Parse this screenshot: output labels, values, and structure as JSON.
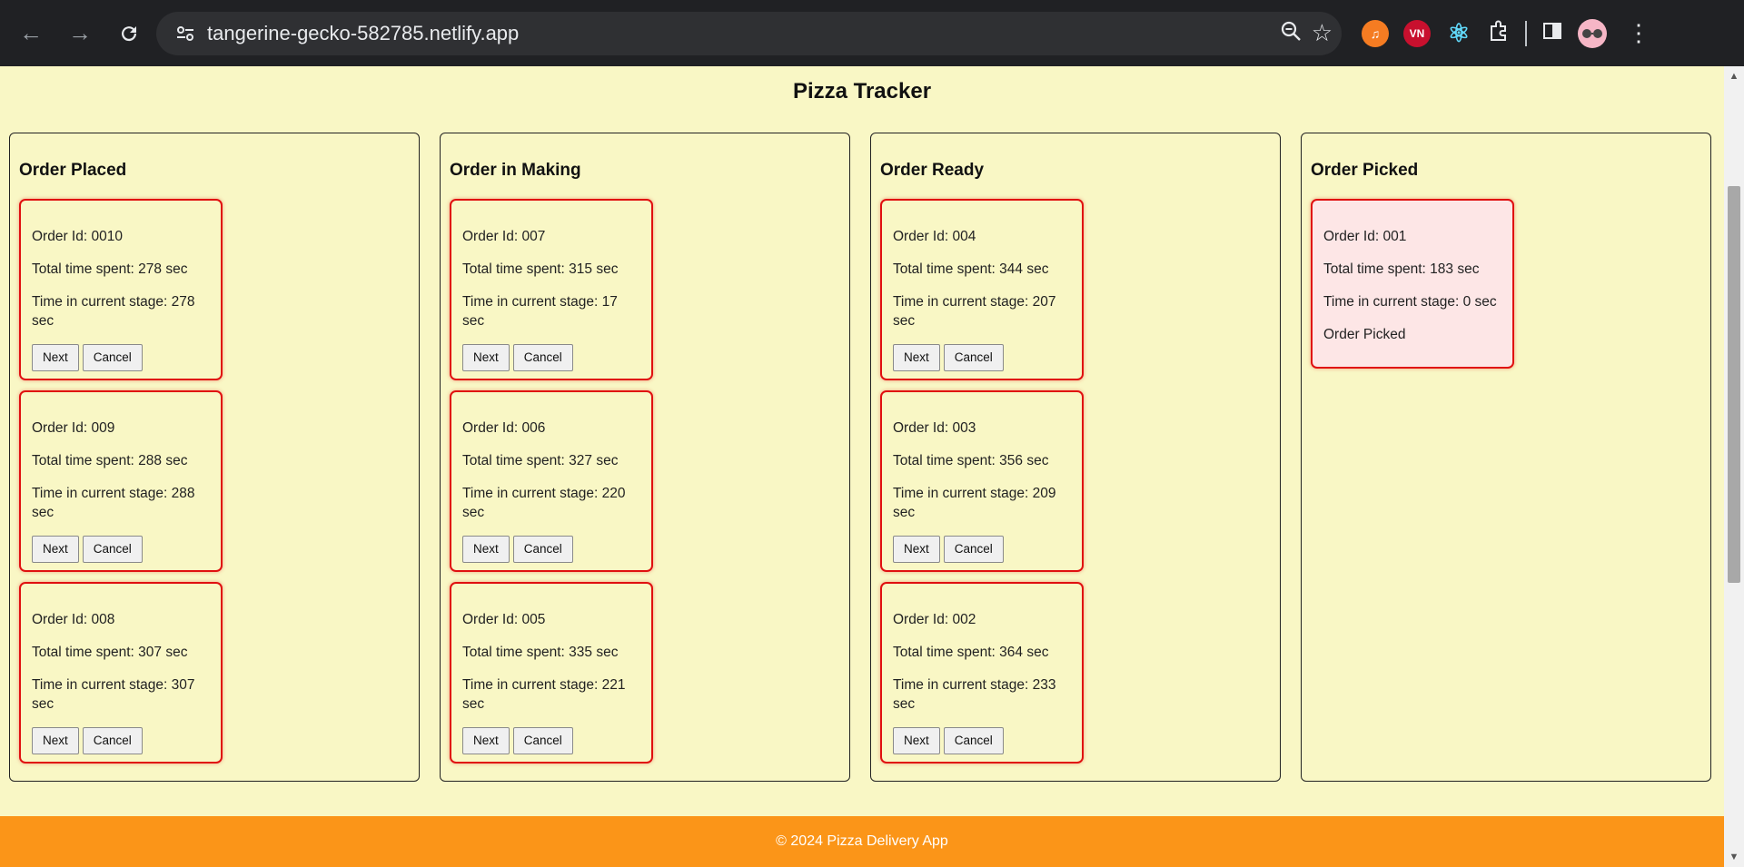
{
  "browser": {
    "url": "tangerine-gecko-582785.netlify.app",
    "extensions": [
      {
        "icon": "pdf-orange-extension-icon",
        "color": "#f57c22",
        "label": "♫"
      },
      {
        "icon": "vn-red-extension-icon",
        "color": "#c8102e",
        "label": "VN"
      },
      {
        "icon": "react-devtools-icon",
        "color": "#61dafb",
        "label": "⚛"
      }
    ]
  },
  "page": {
    "title": "Pizza Tracker",
    "footer": "© 2024 Pizza Delivery App"
  },
  "labels": {
    "order_id_prefix": "Order Id: ",
    "total_prefix": "Total time spent: ",
    "stage_prefix": "Time in current stage: ",
    "next": "Next",
    "cancel": "Cancel"
  },
  "columns": [
    {
      "title": "Order Placed",
      "orders": [
        {
          "id_text": "Order Id: 0010",
          "total_text": "Total time spent: 278 sec",
          "stage_text": "Time in current stage: 278 sec",
          "next": "Next",
          "cancel": "Cancel"
        },
        {
          "id_text": "Order Id: 009",
          "total_text": "Total time spent: 288 sec",
          "stage_text": "Time in current stage: 288 sec",
          "next": "Next",
          "cancel": "Cancel"
        },
        {
          "id_text": "Order Id: 008",
          "total_text": "Total time spent: 307 sec",
          "stage_text": "Time in current stage: 307 sec",
          "next": "Next",
          "cancel": "Cancel"
        }
      ]
    },
    {
      "title": "Order in Making",
      "orders": [
        {
          "id_text": "Order Id: 007",
          "total_text": "Total time spent: 315 sec",
          "stage_text": "Time in current stage: 17 sec",
          "next": "Next",
          "cancel": "Cancel"
        },
        {
          "id_text": "Order Id: 006",
          "total_text": "Total time spent: 327 sec",
          "stage_text": "Time in current stage: 220 sec",
          "next": "Next",
          "cancel": "Cancel"
        },
        {
          "id_text": "Order Id: 005",
          "total_text": "Total time spent: 335 sec",
          "stage_text": "Time in current stage: 221 sec",
          "next": "Next",
          "cancel": "Cancel"
        }
      ]
    },
    {
      "title": "Order Ready",
      "orders": [
        {
          "id_text": "Order Id: 004",
          "total_text": "Total time spent: 344 sec",
          "stage_text": "Time in current stage: 207 sec",
          "next": "Next",
          "cancel": "Cancel"
        },
        {
          "id_text": "Order Id: 003",
          "total_text": "Total time spent: 356 sec",
          "stage_text": "Time in current stage: 209 sec",
          "next": "Next",
          "cancel": "Cancel"
        },
        {
          "id_text": "Order Id: 002",
          "total_text": "Total time spent: 364 sec",
          "stage_text": "Time in current stage: 233 sec",
          "next": "Next",
          "cancel": "Cancel"
        }
      ]
    },
    {
      "title": "Order Picked",
      "orders": [
        {
          "id_text": "Order Id: 001",
          "total_text": "Total time spent: 183 sec",
          "stage_text": "Time in current stage: 0 sec",
          "status_text": "Order Picked"
        }
      ]
    }
  ],
  "colors": {
    "page_bg": "#f9f7c5",
    "card_border": "#e01010",
    "picked_card_bg": "#fde6e6",
    "footer_bg": "#fb9518"
  }
}
